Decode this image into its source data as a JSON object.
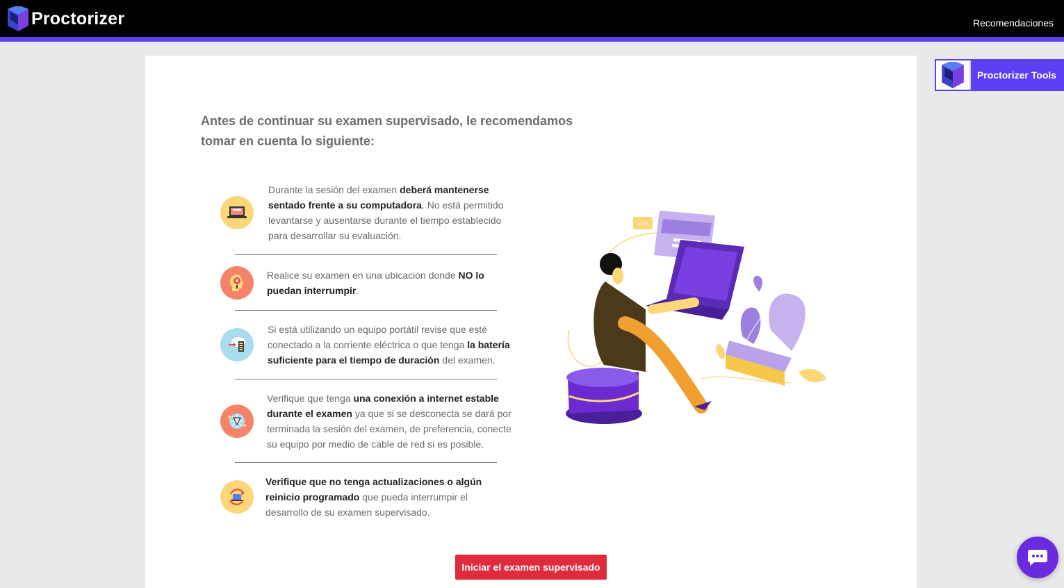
{
  "header": {
    "brand": "Proctorizer",
    "nav_link": "Recomendaciones"
  },
  "colors": {
    "accent": "#5a3ff5",
    "button": "#e02b3d",
    "chat": "#6a2ae0"
  },
  "main": {
    "intro": "Antes de continuar su examen supervisado, le recomendamos tomar en cuenta lo siguiente:",
    "recommendations": [
      {
        "icon": "laptop-icon",
        "parts": [
          "Durante la sesión del examen ",
          "deberá mantenerse sentado frente a su computadora",
          ". No está permitido levantarse y ausentarse durante el tiempo establecido para desarrollar su evaluación."
        ]
      },
      {
        "icon": "head-warning-icon",
        "parts": [
          "Realice su examen en una ubicación donde ",
          "NO lo puedan interrumpir",
          "."
        ]
      },
      {
        "icon": "battery-plug-icon",
        "parts": [
          "Si está utilizando un equipo portátil revise que esté conectado a la corriente eléctrica o que tenga ",
          "la batería suficiente para el tiempo de duración",
          " del examen."
        ]
      },
      {
        "icon": "network-icon",
        "parts": [
          "Verifique que tenga ",
          "una conexión a internet estable durante el examen",
          " ya que si se desconecta se dará por terminada la sesión del examen, de preferencia, conecte su equipo por medio de cable de red si es posible."
        ]
      },
      {
        "icon": "update-icon",
        "parts": [
          "",
          "Verifique que no tenga actualizaciones o algún reinicio programado",
          " que pueda interrumpir el desarrollo de su examen supervisado."
        ]
      }
    ],
    "start_button": "Iniciar el examen supervisado"
  },
  "tools": {
    "label": "Proctorizer Tools"
  },
  "chat": {
    "icon": "chat-bubble-icon"
  }
}
